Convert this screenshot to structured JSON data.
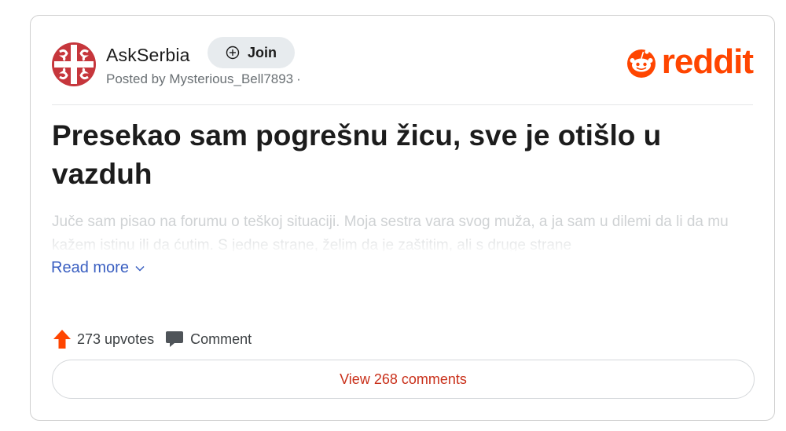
{
  "post": {
    "community": "AskSerbia",
    "join_label": "Join",
    "posted_by_prefix": "Posted by ",
    "author": "Mysterious_Bell7893",
    "separator": "·",
    "brand": "reddit",
    "title": "Presekao sam pogrešnu žicu, sve je otišlo u vazduh",
    "excerpt": "Juče sam pisao na forumu o teškoj situaciji. Moja sestra vara svog muža, a ja sam u dilemi da li da mu kažem istinu ili da ćutim. S jedne strane, želim da je zaštitim, ali s druge strane",
    "read_more": "Read more",
    "upvotes": "273 upvotes",
    "comment_label": "Comment",
    "view_comments": "View 268 comments"
  },
  "icons": {
    "join": "plus-circle-icon",
    "read_more": "chevron-down-icon",
    "upvote": "upvote-arrow-icon",
    "comment": "comment-bubble-icon",
    "brand": "reddit-snoo-icon",
    "avatar": "serbian-cross-icon"
  },
  "colors": {
    "brand": "#ff4500",
    "link": "#3a5fc1",
    "view_comments": "#c9301a",
    "join_bg": "#e7ebee",
    "avatar_red": "#c6363c"
  }
}
